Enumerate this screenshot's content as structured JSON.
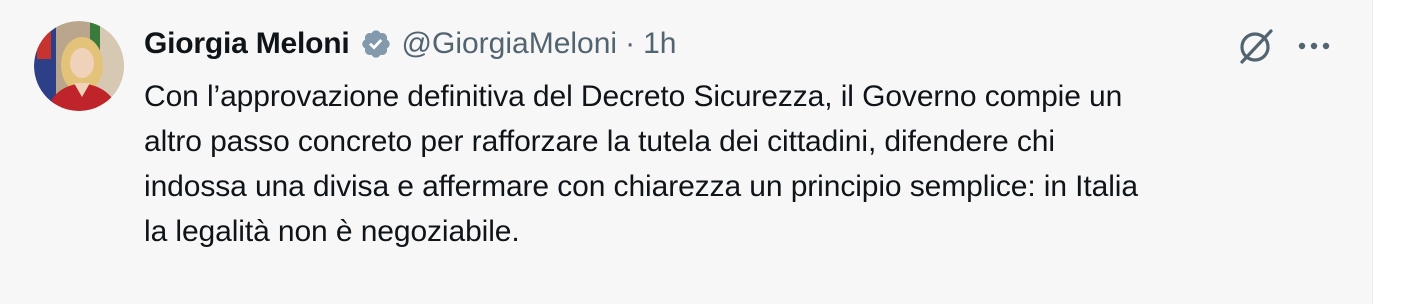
{
  "tweet": {
    "author_name": "Giorgia Meloni",
    "handle": "@GiorgiaMeloni",
    "separator": "·",
    "time": "1h",
    "text": "Con l’approvazione definitiva del Decreto Sicurezza, il Governo compie un\naltro passo concreto per rafforzare la tutela dei cittadini, difendere chi\nindossa una divisa e affermare con chiarezza un principio semplice: in Italia\nla legalità non è negoziabile."
  },
  "icons": {
    "verified": "verified-badge-icon",
    "grok": "grok-icon",
    "more": "more-options-icon"
  },
  "colors": {
    "text": "#0f1419",
    "secondary": "#536471",
    "verified_badge": "#829aab",
    "card_background": "#f7f7f7"
  }
}
